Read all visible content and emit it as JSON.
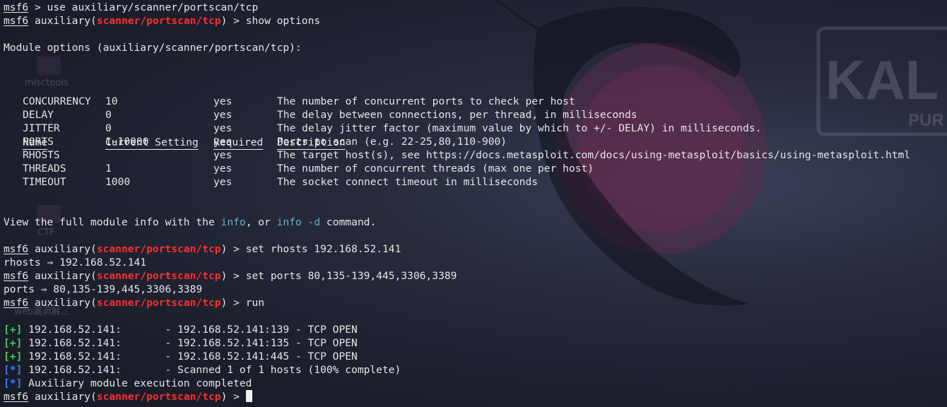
{
  "prompt": {
    "host": "msf6",
    "module_prefix": "auxiliary(",
    "module": "scanner/portscan/tcp",
    "module_suffix": ") > "
  },
  "commands": {
    "use": "> use auxiliary/scanner/portscan/tcp",
    "show": "show options",
    "set_rhosts": "set rhosts 192.168.52.141",
    "set_ports": "set ports 80,135-139,445,3306,3389",
    "run": "run"
  },
  "module_options_title": "Module options (auxiliary/scanner/portscan/tcp):",
  "table": {
    "headers": [
      "Name",
      "Current Setting",
      "Required",
      "Description"
    ],
    "rows": [
      {
        "name": "CONCURRENCY",
        "setting": "10",
        "required": "yes",
        "description": "The number of concurrent ports to check per host"
      },
      {
        "name": "DELAY",
        "setting": "0",
        "required": "yes",
        "description": "The delay between connections, per thread, in milliseconds"
      },
      {
        "name": "JITTER",
        "setting": "0",
        "required": "yes",
        "description": "The delay jitter factor (maximum value by which to +/- DELAY) in milliseconds."
      },
      {
        "name": "PORTS",
        "setting": "1-10000",
        "required": "yes",
        "description": "Ports to scan (e.g. 22-25,80,110-900)"
      },
      {
        "name": "RHOSTS",
        "setting": "",
        "required": "yes",
        "description": "The target host(s), see https://docs.metasploit.com/docs/using-metasploit/basics/using-metasploit.html"
      },
      {
        "name": "THREADS",
        "setting": "1",
        "required": "yes",
        "description": "The number of concurrent threads (max one per host)"
      },
      {
        "name": "TIMEOUT",
        "setting": "1000",
        "required": "yes",
        "description": "The socket connect timeout in milliseconds"
      }
    ]
  },
  "info_line": {
    "before": "View the full module info with the ",
    "info": "info",
    "middle": ", or ",
    "info_d": "info -d",
    "after": " command."
  },
  "rhosts_echo": "rhosts ⇒ 192.168.52.141",
  "ports_echo": "ports ⇒ 80,135-139,445,3306,3389",
  "results": [
    {
      "marker": "[+]",
      "text": " 192.168.52.141:       - 192.168.52.141:139 - TCP OPEN"
    },
    {
      "marker": "[+]",
      "text": " 192.168.52.141:       - 192.168.52.141:135 - TCP OPEN"
    },
    {
      "marker": "[+]",
      "text": " 192.168.52.141:       - 192.168.52.141:445 - TCP OPEN"
    },
    {
      "marker": "[*]",
      "text": " 192.168.52.141:       - Scanned 1 of 1 hosts (100% complete)"
    },
    {
      "marker": "[*]",
      "text": " Auxiliary module execution completed"
    }
  ],
  "wallpaper": {
    "labels": [
      "misctools",
      "CTF",
      "web漏洞解..."
    ],
    "logo_text": "KAL",
    "logo_sub": "PUR"
  },
  "colors": {
    "module_red": "#ff2d2d",
    "plus_green": "#3fcf5c",
    "star_blue": "#3d7bff",
    "info_cyan": "#5fb3c8"
  }
}
